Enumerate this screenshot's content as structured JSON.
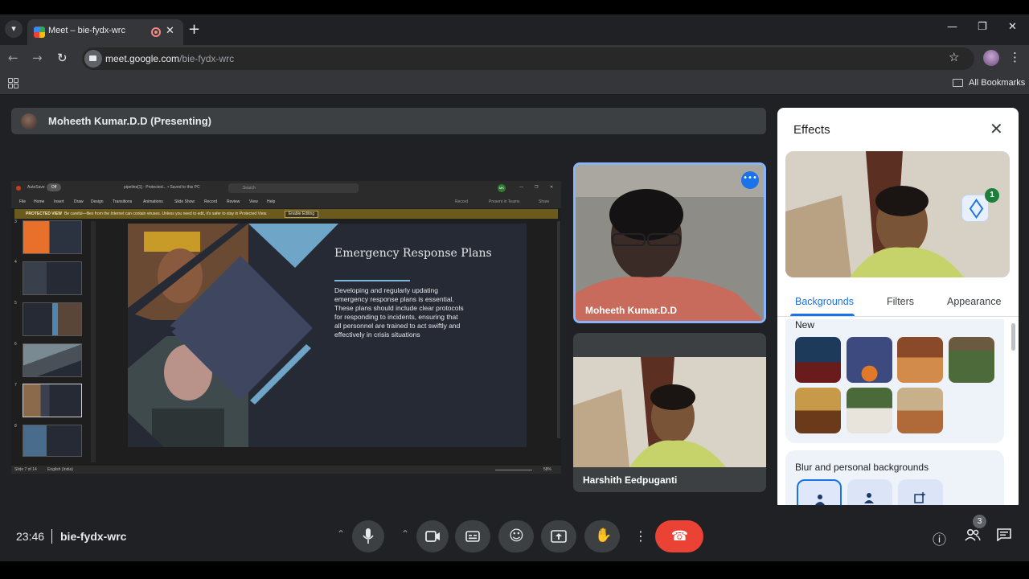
{
  "browser": {
    "tab_title": "Meet – bie-fydx-wrc",
    "tab_close_glyph": "✕",
    "new_tab_glyph": "+",
    "url_host": "meet.google.com",
    "url_path": "/bie-fydx-wrc",
    "all_bookmarks": "All Bookmarks",
    "icons": [
      "tab-list-icon",
      "back-icon",
      "forward-icon",
      "reload-icon",
      "star-icon",
      "profile-avatar",
      "menu-icon",
      "apps-icon",
      "folder-icon"
    ]
  },
  "meet": {
    "presenter_label": "Moheeth Kumar.D.D (Presenting)",
    "participants": [
      {
        "name": "Moheeth Kumar.D.D",
        "speaking": true
      },
      {
        "name": "Harshith Eedpuganti",
        "speaking": false
      }
    ],
    "clock": "23:46",
    "meeting_code": "bie-fydx-wrc",
    "people_count": "3",
    "end_call_color": "#ea4335",
    "accent": "#8ab4f8"
  },
  "shared_screen": {
    "titlebar": {
      "autosave": "AutoSave",
      "autosave_state": "Off",
      "doc_name": "pipeline[1] · Protected... • Saved to this PC",
      "search": "Search",
      "user_initials": "MK"
    },
    "menu": [
      "File",
      "Home",
      "Insert",
      "Draw",
      "Design",
      "Transitions",
      "Animations",
      "Slide Show",
      "Record",
      "Review",
      "View",
      "Help"
    ],
    "ribbon_right": [
      "Record",
      "Present in Teams",
      "Share"
    ],
    "protected_view": {
      "label": "PROTECTED VIEW",
      "message": "Be careful—files from the Internet can contain viruses. Unless you need to edit, it's safer to stay in Protected View.",
      "button": "Enable Editing"
    },
    "thumbnails": [
      {
        "num": "3",
        "selected": false
      },
      {
        "num": "4",
        "selected": false
      },
      {
        "num": "5",
        "selected": false
      },
      {
        "num": "6",
        "selected": false
      },
      {
        "num": "7",
        "selected": true
      },
      {
        "num": "8",
        "selected": false
      }
    ],
    "slide": {
      "title": "Emergency Response Plans",
      "body": "Developing and regularly updating\nemergency response plans  is essential.\nThese plans should include clear protocols\nfor responding to incidents, ensuring that\nall personnel are trained to act swiftly and\neffectively in crisis situations"
    },
    "status": {
      "slide_of": "Slide 7 of 14",
      "language": "English (India)",
      "zoom": "58%"
    }
  },
  "effects_panel": {
    "title": "Effects",
    "close_glyph": "✕",
    "applied_count": "1",
    "tabs": [
      {
        "label": "Backgrounds",
        "active": true
      },
      {
        "label": "Filters",
        "active": false
      },
      {
        "label": "Appearance",
        "active": false
      }
    ],
    "new_section": "New",
    "new_backgrounds": [
      "gothic-library",
      "halloween-night",
      "cozy-bedroom",
      "garden-patio",
      "vintage-room",
      "greenhouse-table",
      "autumn-cafe"
    ],
    "blur_section": "Blur and personal backgrounds",
    "blur_options": [
      "no-effect",
      "slight-blur",
      "upload-background"
    ]
  }
}
